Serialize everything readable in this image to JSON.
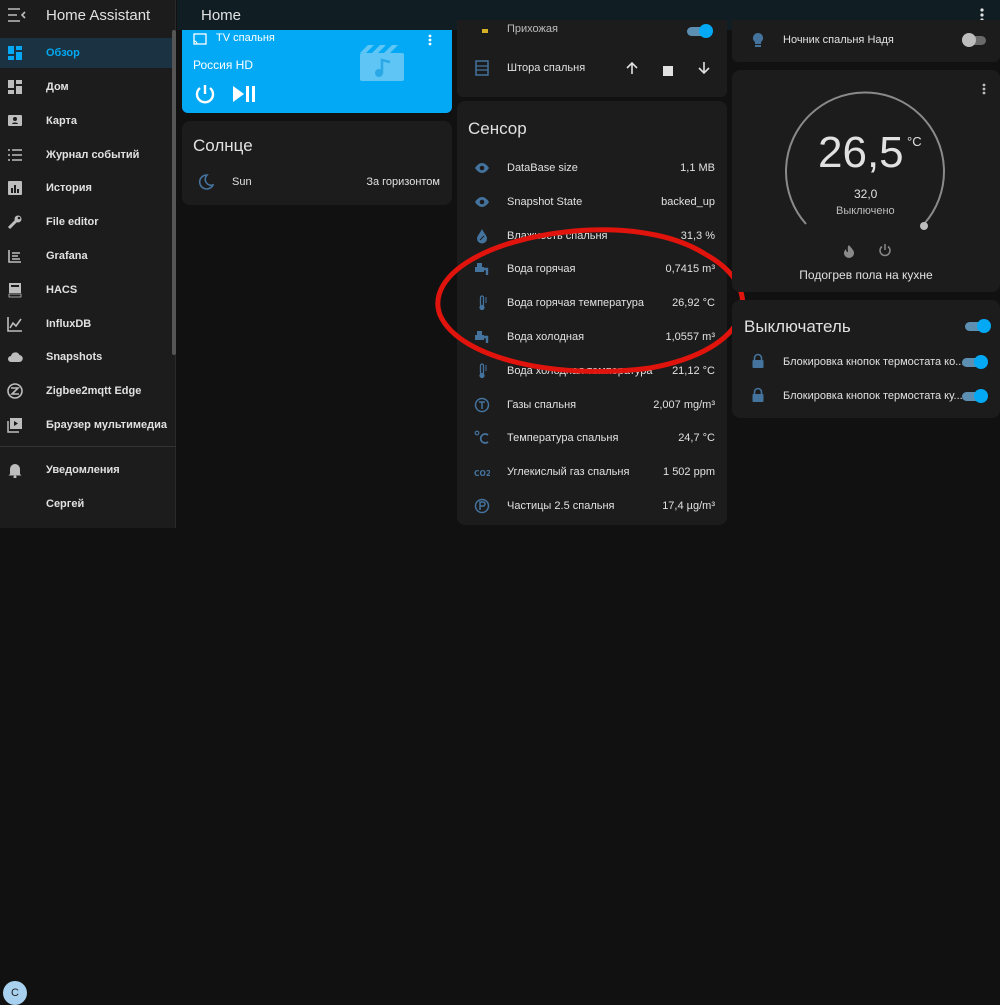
{
  "app": {
    "title": "Home Assistant"
  },
  "header": {
    "title": "Home"
  },
  "sidebar": {
    "items": [
      {
        "label": "Обзор",
        "icon": "dashboard-icon",
        "active": true
      },
      {
        "label": "Дом",
        "icon": "dashboard-icon"
      },
      {
        "label": "Карта",
        "icon": "map-icon"
      },
      {
        "label": "Журнал событий",
        "icon": "list-icon"
      },
      {
        "label": "История",
        "icon": "chart-icon"
      },
      {
        "label": "File editor",
        "icon": "wrench-icon"
      },
      {
        "label": "Grafana",
        "icon": "grafana-icon"
      },
      {
        "label": "HACS",
        "icon": "hacs-icon"
      },
      {
        "label": "InfluxDB",
        "icon": "line-chart-icon"
      },
      {
        "label": "Snapshots",
        "icon": "cloud-icon"
      },
      {
        "label": "Zigbee2mqtt Edge",
        "icon": "zigbee-icon"
      },
      {
        "label": "Браузер мультимедиа",
        "icon": "media-icon"
      }
    ],
    "notifications_label": "Уведомления",
    "user": {
      "name": "Сергей",
      "initial": "С"
    }
  },
  "media_card": {
    "device": "TV спальня",
    "channel": "Россия HD"
  },
  "sun_card": {
    "title": "Солнце",
    "row_label": "Sun",
    "row_value": "За горизонтом"
  },
  "col2_top": {
    "partial_label": "Прихожая",
    "curtain_label": "Штора спальня"
  },
  "sensor_card": {
    "title": "Сенсор",
    "rows": [
      {
        "label": "DataBase size",
        "value": "1,1 MB",
        "icon": "eye-icon"
      },
      {
        "label": "Snapshot State",
        "value": "backed_up",
        "icon": "eye-icon"
      },
      {
        "label": "Влажность спальня",
        "value": "31,3 %",
        "icon": "water-percent-icon"
      },
      {
        "label": "Вода горячая",
        "value": "0,7415 m³",
        "icon": "water-pump-icon"
      },
      {
        "label": "Вода горячая температура",
        "value": "26,92 °C",
        "icon": "thermometer-icon"
      },
      {
        "label": "Вода холодная",
        "value": "1,0557 m³",
        "icon": "water-pump-icon"
      },
      {
        "label": "Вода холодная температура",
        "value": "21,12 °C",
        "icon": "thermometer-icon"
      },
      {
        "label": "Газы спальня",
        "value": "2,007 mg/m³",
        "icon": "gas-icon"
      },
      {
        "label": "Температура спальня",
        "value": "24,7 °C",
        "icon": "celsius-icon"
      },
      {
        "label": "Углекислый газ спальня",
        "value": "1 502 ppm",
        "icon": "co2-icon"
      },
      {
        "label": "Частицы 2.5 спальня",
        "value": "17,4 µg/m³",
        "icon": "particles-icon"
      }
    ]
  },
  "nightlight": {
    "label": "Ночник спальня Надя",
    "state": "off"
  },
  "thermostat": {
    "current": "26,5",
    "unit": "°C",
    "target": "32,0",
    "status": "Выключено",
    "name": "Подогрев пола на кухне"
  },
  "switch_card": {
    "title": "Выключатель",
    "rows": [
      {
        "label": "Блокировка кнопок термостата ко...",
        "state": "on"
      },
      {
        "label": "Блокировка кнопок термостата ку...",
        "state": "on"
      }
    ]
  },
  "colors": {
    "accent": "#03a9f4",
    "annotation": "#e0140c",
    "icon": "#44739e"
  }
}
